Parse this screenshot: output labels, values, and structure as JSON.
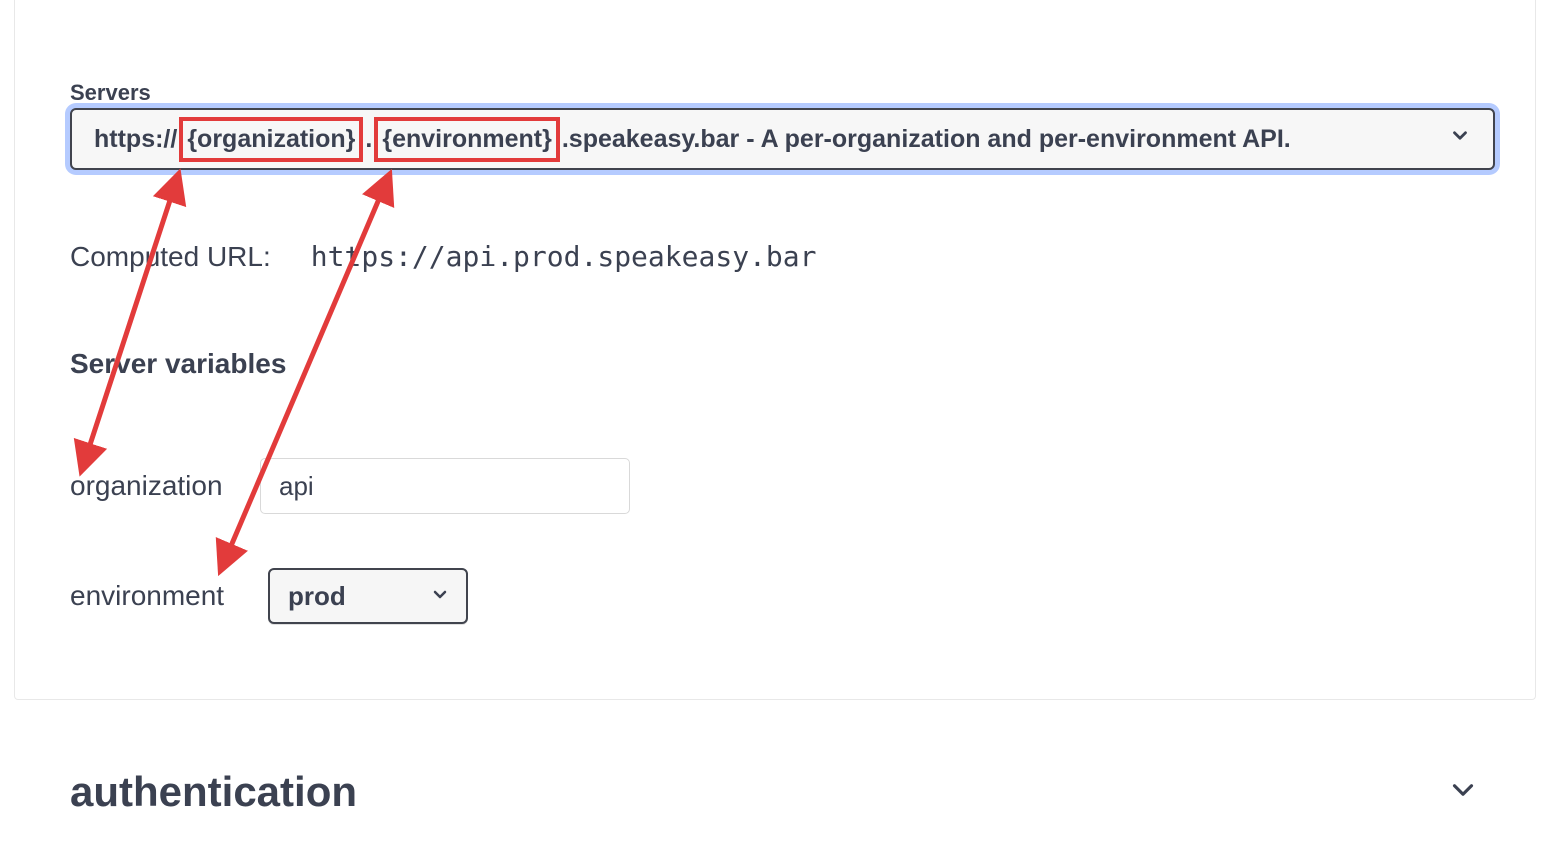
{
  "servers": {
    "label": "Servers",
    "selected": {
      "prefix": "https://",
      "var1": "{organization}",
      "sep": ".",
      "var2": "{environment}",
      "suffix": ".speakeasy.bar - A per-organization and per-environment API."
    }
  },
  "computed": {
    "label": "Computed URL:",
    "url": "https://api.prod.speakeasy.bar"
  },
  "server_variables": {
    "heading": "Server variables",
    "organization": {
      "label": "organization",
      "value": "api"
    },
    "environment": {
      "label": "environment",
      "value": "prod"
    }
  },
  "authentication": {
    "title": "authentication"
  },
  "annotation": {
    "color": "#e23b3b"
  }
}
